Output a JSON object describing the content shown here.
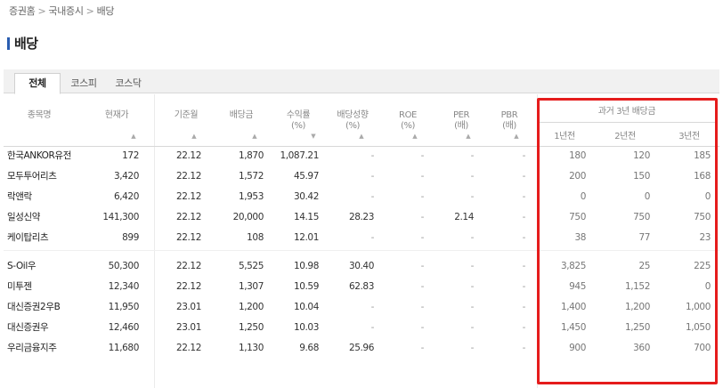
{
  "breadcrumb": {
    "home": "증권홈",
    "section": "국내증시",
    "current": "배당"
  },
  "page_title": "배당",
  "tabs": [
    "전체",
    "코스피",
    "코스닥"
  ],
  "headers": {
    "name": "종목명",
    "price": "현재가",
    "base_month": "기준월",
    "dividend": "배당금",
    "yield_l1": "수익률",
    "yield_l2": "(%)",
    "payout_l1": "배당성향",
    "payout_l2": "(%)",
    "roe_l1": "ROE",
    "roe_l2": "(%)",
    "per_l1": "PER",
    "per_l2": "(배)",
    "pbr_l1": "PBR",
    "pbr_l2": "(배)",
    "history": "과거 3년 배당금",
    "y1": "1년전",
    "y2": "2년전",
    "y3": "3년전"
  },
  "sort_marker": "▲",
  "rows": [
    {
      "name": "한국ANKOR유전",
      "price": "172",
      "base": "22.12",
      "div": "1,870",
      "yield": "1,087.21",
      "payout": "-",
      "roe": "-",
      "per": "-",
      "pbr": "-",
      "y1": "180",
      "y2": "120",
      "y3": "185"
    },
    {
      "name": "모두투어리츠",
      "price": "3,420",
      "base": "22.12",
      "div": "1,572",
      "yield": "45.97",
      "payout": "-",
      "roe": "-",
      "per": "-",
      "pbr": "-",
      "y1": "200",
      "y2": "150",
      "y3": "168"
    },
    {
      "name": "락앤락",
      "price": "6,420",
      "base": "22.12",
      "div": "1,953",
      "yield": "30.42",
      "payout": "-",
      "roe": "-",
      "per": "-",
      "pbr": "-",
      "y1": "0",
      "y2": "0",
      "y3": "0"
    },
    {
      "name": "일성신약",
      "price": "141,300",
      "base": "22.12",
      "div": "20,000",
      "yield": "14.15",
      "payout": "28.23",
      "roe": "-",
      "per": "2.14",
      "pbr": "-",
      "y1": "750",
      "y2": "750",
      "y3": "750"
    },
    {
      "name": "케이탑리츠",
      "price": "899",
      "base": "22.12",
      "div": "108",
      "yield": "12.01",
      "payout": "-",
      "roe": "-",
      "per": "-",
      "pbr": "-",
      "y1": "38",
      "y2": "77",
      "y3": "23"
    },
    {
      "name": "S-Oil우",
      "price": "50,300",
      "base": "22.12",
      "div": "5,525",
      "yield": "10.98",
      "payout": "30.40",
      "roe": "-",
      "per": "-",
      "pbr": "-",
      "y1": "3,825",
      "y2": "25",
      "y3": "225"
    },
    {
      "name": "미투젠",
      "price": "12,340",
      "base": "22.12",
      "div": "1,307",
      "yield": "10.59",
      "payout": "62.83",
      "roe": "-",
      "per": "-",
      "pbr": "-",
      "y1": "945",
      "y2": "1,152",
      "y3": "0"
    },
    {
      "name": "대신증권2우B",
      "price": "11,950",
      "base": "23.01",
      "div": "1,200",
      "yield": "10.04",
      "payout": "-",
      "roe": "-",
      "per": "-",
      "pbr": "-",
      "y1": "1,400",
      "y2": "1,200",
      "y3": "1,000"
    },
    {
      "name": "대신증권우",
      "price": "12,460",
      "base": "23.01",
      "div": "1,250",
      "yield": "10.03",
      "payout": "-",
      "roe": "-",
      "per": "-",
      "pbr": "-",
      "y1": "1,450",
      "y2": "1,250",
      "y3": "1,050"
    },
    {
      "name": "우리금융지주",
      "price": "11,680",
      "base": "22.12",
      "div": "1,130",
      "yield": "9.68",
      "payout": "25.96",
      "roe": "-",
      "per": "-",
      "pbr": "-",
      "y1": "900",
      "y2": "360",
      "y3": "700"
    }
  ],
  "colors": {
    "highlight_border": "#e51c1c",
    "title_bar": "#2a5db0"
  }
}
